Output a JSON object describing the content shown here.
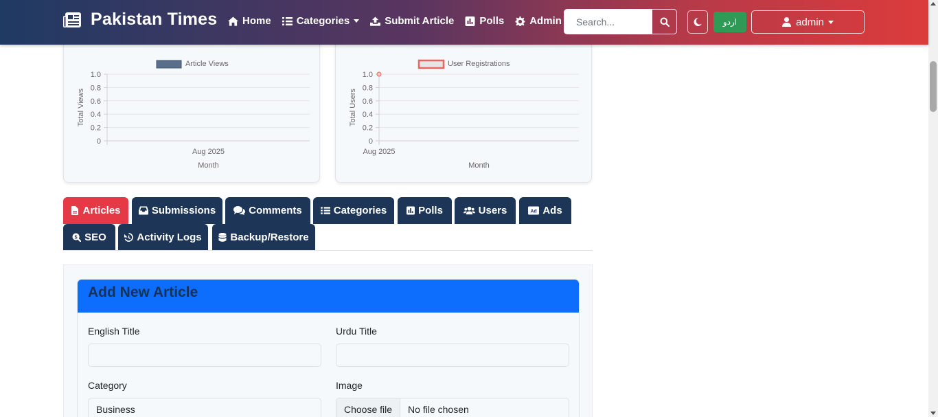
{
  "brand": {
    "name": "Pakistan Times",
    "icon": "newspaper-icon"
  },
  "nav": {
    "home": "Home",
    "categories": "Categories",
    "submit_article": "Submit Article",
    "polls": "Polls",
    "admin": "Admin"
  },
  "search": {
    "placeholder": "Search..."
  },
  "lang_toggle": "اردو",
  "user_menu": {
    "label": "admin"
  },
  "colors": {
    "accent_red": "#e53945",
    "navy": "#1d3557",
    "primary_blue": "#0d6efd",
    "green": "#2e9a55"
  },
  "chart_data": [
    {
      "type": "bar",
      "legend": [
        "Article Views"
      ],
      "categories": [
        "Aug 2025"
      ],
      "series": [
        {
          "name": "Article Views",
          "values": [
            0
          ],
          "color": "#5a6e8a"
        }
      ],
      "xlabel": "Month",
      "ylabel": "Total Views",
      "yticks": [
        "0",
        "0.2",
        "0.4",
        "0.6",
        "0.8",
        "1.0"
      ],
      "ylim": [
        0,
        1
      ],
      "grid": true,
      "legend_position": "top"
    },
    {
      "type": "line",
      "legend": [
        "User Registrations"
      ],
      "categories": [
        "Aug 2025"
      ],
      "series": [
        {
          "name": "User Registrations",
          "values": [
            1
          ],
          "color": "#e8645e"
        }
      ],
      "xlabel": "Month",
      "ylabel": "Total Users",
      "yticks": [
        "0",
        "0.2",
        "0.4",
        "0.6",
        "0.8",
        "1.0"
      ],
      "ylim": [
        0,
        1
      ],
      "grid": true,
      "legend_position": "top"
    }
  ],
  "tabs": [
    {
      "label": "Articles",
      "icon": "file-icon",
      "active": true
    },
    {
      "label": "Submissions",
      "icon": "inbox-icon"
    },
    {
      "label": "Comments",
      "icon": "comments-icon"
    },
    {
      "label": "Categories",
      "icon": "list-icon"
    },
    {
      "label": "Polls",
      "icon": "poll-icon"
    },
    {
      "label": "Users",
      "icon": "users-icon"
    },
    {
      "label": "Ads",
      "icon": "ad-icon"
    },
    {
      "label": "SEO",
      "icon": "search-dollar-icon"
    },
    {
      "label": "Activity Logs",
      "icon": "history-icon"
    },
    {
      "label": "Backup/Restore",
      "icon": "database-icon"
    }
  ],
  "form": {
    "title": "Add New Article",
    "english_title_label": "English Title",
    "english_title_value": "",
    "urdu_title_label": "Urdu Title",
    "urdu_title_value": "",
    "category_label": "Category",
    "category_value": "Business",
    "image_label": "Image",
    "file_button": "Choose file",
    "file_status": "No file chosen"
  }
}
